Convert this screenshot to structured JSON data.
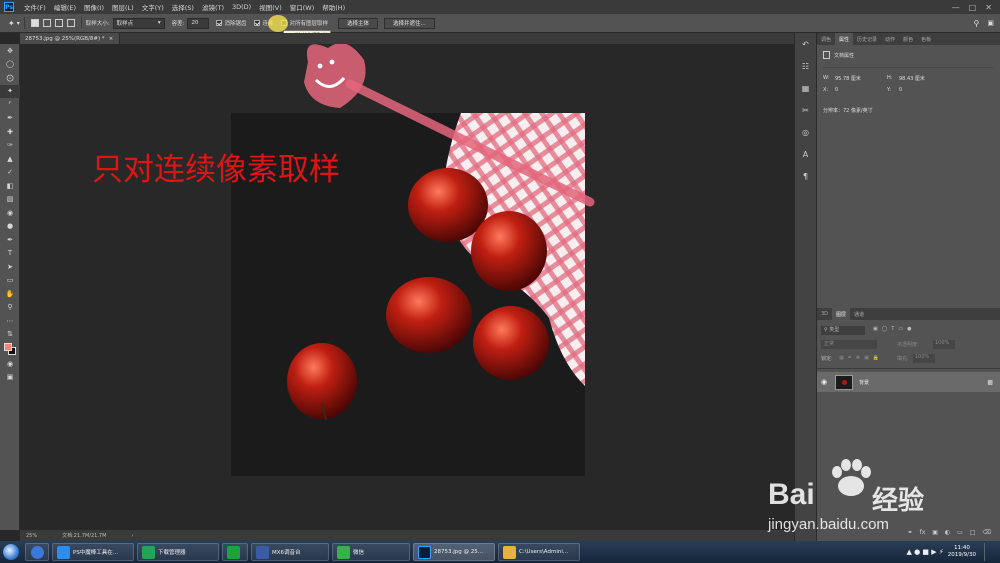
{
  "app": {
    "logo": "Ps"
  },
  "menu": [
    "文件(F)",
    "编辑(E)",
    "图像(I)",
    "图层(L)",
    "文字(Y)",
    "选择(S)",
    "滤镜(T)",
    "3D(D)",
    "视图(V)",
    "窗口(W)",
    "帮助(H)"
  ],
  "options": {
    "sample_size_label": "取样大小:",
    "sample_size_value": "取样点",
    "tolerance_label": "容差:",
    "tolerance_value": "20",
    "antialias_label": "消除锯齿",
    "contiguous_label": "连续",
    "sample_all_label": "对所有图层取样",
    "select_subject": "选择主体",
    "select_mask": "选择并遮住..."
  },
  "tooltip": "只对连续像素取样",
  "document": {
    "tab_title": "28753.jpg @ 25%(RGB/8#) *",
    "annotation": "只对连续像素取样"
  },
  "status": {
    "zoom": "25%",
    "doc_size": "文档:21.7M/21.7M"
  },
  "properties": {
    "tabs": [
      "调色",
      "属性",
      "历史记录",
      "动作",
      "颜色",
      "色板"
    ],
    "active_tab": "属性",
    "title": "文档属性",
    "w_label": "W:",
    "w_value": "95.78 厘米",
    "h_label": "H:",
    "h_value": "98.43 厘米",
    "x_label": "X:",
    "x_value": "0",
    "y_label": "Y:",
    "y_value": "0",
    "resolution": "分辨率：72 像素/英寸"
  },
  "layers": {
    "tabs": [
      "3D",
      "图层",
      "通道"
    ],
    "active_tab": "图层",
    "kind_label": "类型",
    "blend": "正常",
    "opacity_label": "不透明度:",
    "opacity_value": "100%",
    "lock_label": "锁定:",
    "fill_label": "填充:",
    "fill_value": "100%",
    "items": [
      {
        "name": "背景"
      }
    ]
  },
  "watermark": {
    "brand": "Bai",
    "brand2": "经验",
    "url": "jingyan.baidu.com"
  },
  "taskbar": {
    "items": [
      {
        "label": "PS中魔棒工具在...",
        "color": "#2d8cf0"
      },
      {
        "label": "下载管理器",
        "color": "#21a557"
      },
      {
        "label": "",
        "color": "#1fa23a"
      },
      {
        "label": "MX6调音台",
        "color": "#3a5ba8"
      },
      {
        "label": "微信",
        "color": "#35b24a"
      },
      {
        "label": "28753.jpg @ 25...",
        "color": "#0b1d3a"
      },
      {
        "label": "C:\\Users\\Admini...",
        "color": "#e6b43a"
      }
    ],
    "time": "11:40",
    "date": "2019/9/30"
  }
}
